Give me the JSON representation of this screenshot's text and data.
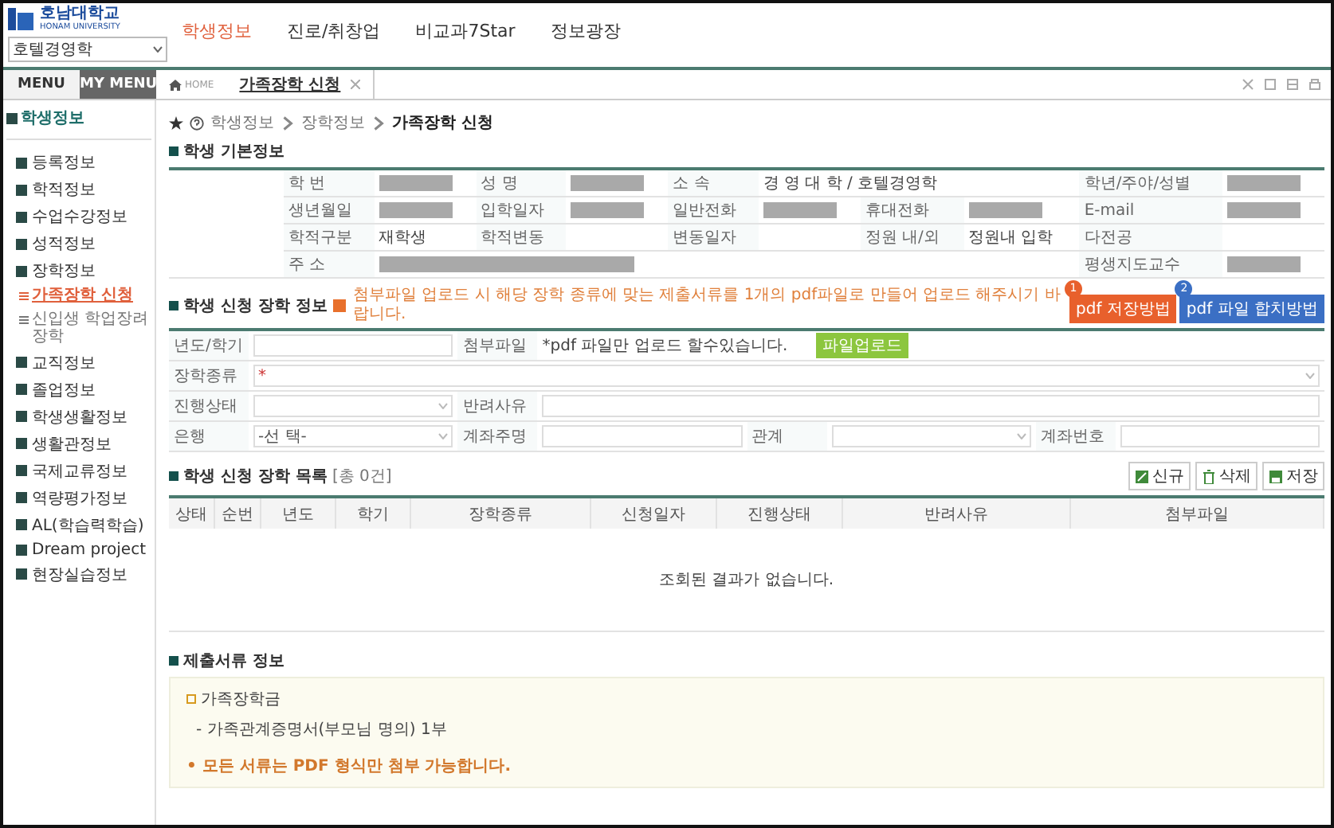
{
  "header": {
    "logo_name": "호남대학교",
    "logo_sub": "HONAM UNIVERSITY",
    "department": "호텔경영학",
    "nav": [
      {
        "label": "학생정보",
        "selected": true
      },
      {
        "label": "진로/취창업",
        "selected": false
      },
      {
        "label": "비교과7Star",
        "selected": false
      },
      {
        "label": "정보광장",
        "selected": false
      }
    ]
  },
  "menu_tabs": [
    {
      "label": "MENU",
      "selected": false
    },
    {
      "label": "MY MENU",
      "selected": true
    }
  ],
  "page_tabs": {
    "home": "HOME",
    "tabs": [
      {
        "label": "가족장학 신청",
        "selected": true
      }
    ]
  },
  "sidebar": {
    "title": "학생정보",
    "items": [
      {
        "label": "등록정보"
      },
      {
        "label": "학적정보"
      },
      {
        "label": "수업수강정보"
      },
      {
        "label": "성적정보"
      },
      {
        "label": "장학정보",
        "children": [
          {
            "label": "가족장학 신청",
            "selected": true
          },
          {
            "label": "신입생 학업장려장학",
            "selected": false
          }
        ]
      },
      {
        "label": "교직정보"
      },
      {
        "label": "졸업정보"
      },
      {
        "label": "학생생활정보"
      },
      {
        "label": "생활관정보"
      },
      {
        "label": "국제교류정보"
      },
      {
        "label": "역량평가정보"
      },
      {
        "label": "AL(학습력학습)"
      },
      {
        "label": "Dream project"
      },
      {
        "label": "현장실습정보"
      }
    ]
  },
  "breadcrumb": [
    "학생정보",
    "장학정보",
    "가족장학 신청"
  ],
  "basic_info": {
    "title": "학생 기본정보",
    "fields": [
      {
        "label": "학 번",
        "redacted": true,
        "row_start": true
      },
      {
        "label": "성 명",
        "redacted": true
      },
      {
        "label": "소 속",
        "value": "경 영 대 학 / 호텔경영학",
        "wide": true
      },
      {
        "label": "학년/주야/성별",
        "redacted": true
      },
      {
        "label": "생년월일",
        "redacted": true,
        "row_start": true
      },
      {
        "label": "입학일자",
        "redacted": true
      },
      {
        "label": "일반전화",
        "redacted": true
      },
      {
        "label": "휴대전화",
        "redacted": true
      },
      {
        "label": "E-mail",
        "redacted": true
      },
      {
        "label": "학적구분",
        "value": "재학생",
        "row_start": true
      },
      {
        "label": "학적변동"
      },
      {
        "label": "변동일자"
      },
      {
        "label": "정원 내/외",
        "value": "정원내 입학"
      },
      {
        "label": "다전공"
      },
      {
        "label": "주 소",
        "redacted": true,
        "wide": true,
        "row_start": true
      },
      {
        "label": "평생지도교수",
        "redacted": true
      }
    ]
  },
  "application": {
    "title": "학생 신청 장학 정보",
    "notice": "첨부파일 업로드 시 해당 장학 종류에 맞는 제출서류를 1개의 pdf파일로 만들어 업로드 해주시기 바랍니다.",
    "help_buttons": [
      {
        "badge": "1",
        "label": "pdf 저장방법",
        "color": "#e8602c"
      },
      {
        "badge": "2",
        "label": "pdf 파일 합치방법",
        "color": "#3b6fc4"
      }
    ],
    "rows": [
      [
        {
          "label": "년도/학기",
          "kind": "input"
        },
        {
          "label": "첨부파일",
          "kind": "file",
          "note": "*pdf 파일만 업로드 할수있습니다.",
          "button": "파일업로드"
        }
      ],
      [
        {
          "label": "장학종류",
          "kind": "select",
          "marker": "*"
        }
      ],
      [
        {
          "label": "진행상태",
          "kind": "select"
        },
        {
          "label": "반려사유",
          "kind": "input"
        }
      ],
      [
        {
          "label": "은행",
          "kind": "select",
          "value": "-선 택-"
        },
        {
          "label": "계좌주명",
          "kind": "input"
        },
        {
          "label": "관계",
          "kind": "select"
        },
        {
          "label": "계좌번호",
          "kind": "input"
        }
      ]
    ]
  },
  "list": {
    "title": "학생 신청 장학 목록",
    "count": "[총 0건]",
    "buttons": [
      {
        "label": "신규",
        "kind": "new"
      },
      {
        "label": "삭제",
        "kind": "delete"
      },
      {
        "label": "저장",
        "kind": "save"
      }
    ],
    "columns": [
      "상태",
      "순번",
      "년도",
      "학기",
      "장학종류",
      "신청일자",
      "진행상태",
      "반려사유",
      "첨부파일"
    ],
    "empty": "조회된 결과가 없습니다."
  },
  "documents": {
    "title": "제출서류 정보",
    "group": "가족장학금",
    "items": [
      "- 가족관계증명서(부모님 명의) 1부"
    ],
    "warning": "• 모든 서류는 PDF 형식만 첨부 가능합니다."
  }
}
